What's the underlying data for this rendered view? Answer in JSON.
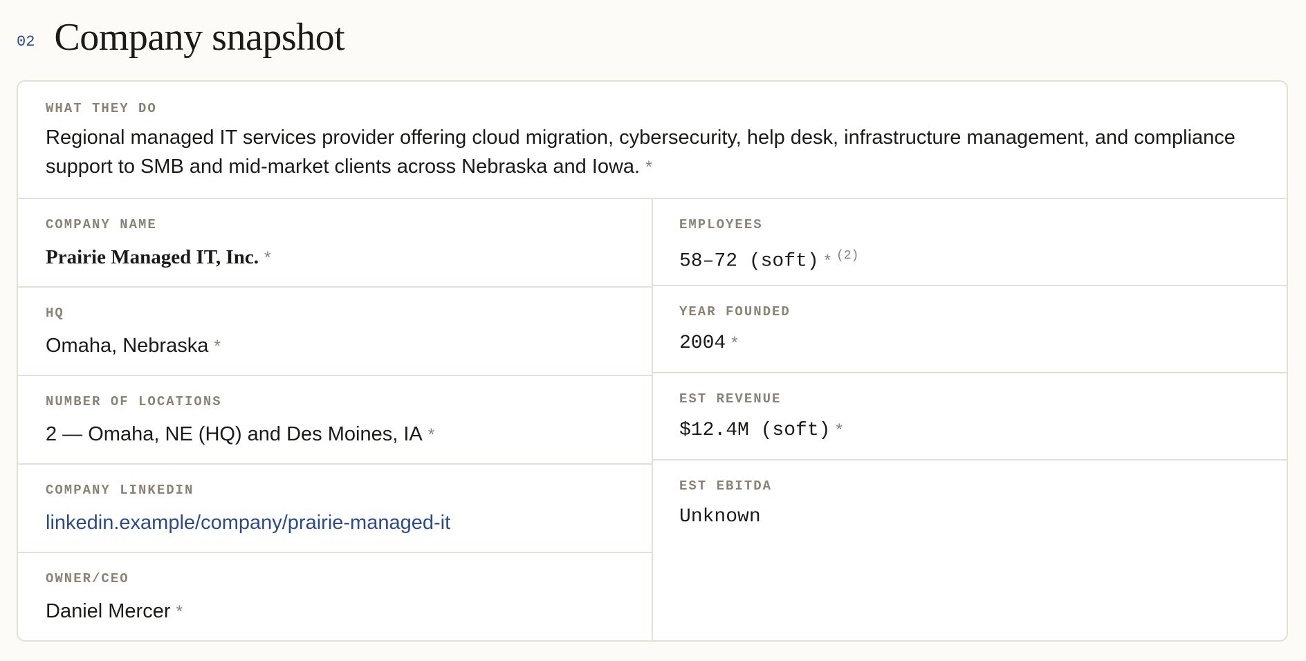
{
  "section": {
    "number": "02",
    "title": "Company snapshot"
  },
  "what_they_do": {
    "label": "WHAT THEY DO",
    "text": "Regional managed IT services provider offering cloud migration, cybersecurity, help desk, infrastructure management, and compliance support to SMB and mid-market clients across Nebraska and Iowa.",
    "marker": "*"
  },
  "left_fields": [
    {
      "label": "COMPANY NAME",
      "value": "Prairie Managed IT, Inc.",
      "marker": "*"
    },
    {
      "label": "HQ",
      "value": "Omaha, Nebraska",
      "marker": "*"
    },
    {
      "label": "NUMBER OF LOCATIONS",
      "value": "2 — Omaha, NE (HQ) and Des Moines, IA",
      "marker": "*"
    },
    {
      "label": "COMPANY LINKEDIN",
      "value": "linkedin.example/company/prairie-managed-it",
      "marker": ""
    },
    {
      "label": "OWNER/CEO",
      "value": "Daniel Mercer",
      "marker": "*"
    }
  ],
  "right_fields": [
    {
      "label": "EMPLOYEES",
      "value": "58–72 (soft)",
      "marker": "*",
      "footnote": "(2)"
    },
    {
      "label": "YEAR FOUNDED",
      "value": "2004",
      "marker": "*"
    },
    {
      "label": "EST REVENUE",
      "value": "$12.4M (soft)",
      "marker": "*"
    },
    {
      "label": "EST EBITDA",
      "value": "Unknown",
      "marker": ""
    }
  ],
  "colors": {
    "accent": "#2b4a8a",
    "label": "#8c8273",
    "border": "#e3dfd2",
    "background": "#fcfbf8"
  }
}
